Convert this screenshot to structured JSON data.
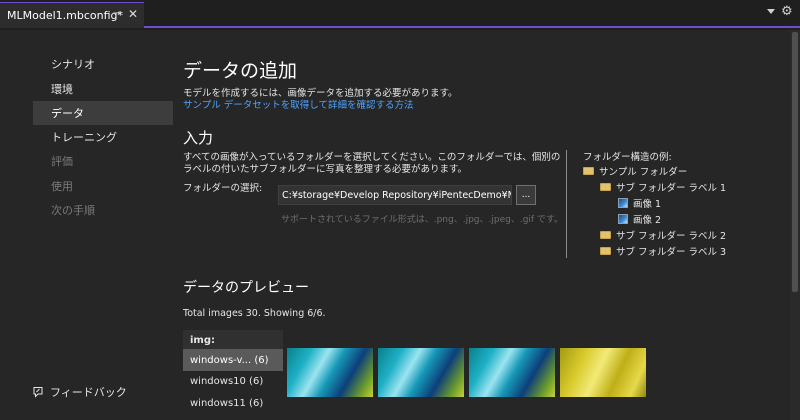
{
  "tab": {
    "title": "MLModel1.mbconfig*",
    "pin": "⊸",
    "close": "✕"
  },
  "sidebar": {
    "items": [
      {
        "label": "シナリオ"
      },
      {
        "label": "環境"
      },
      {
        "label": "データ"
      },
      {
        "label": "トレーニング"
      },
      {
        "label": "評価"
      },
      {
        "label": "使用"
      },
      {
        "label": "次の手順"
      }
    ],
    "feedback": "フィードバック"
  },
  "main": {
    "title": "データの追加",
    "description": "モデルを作成するには、画像データを追加する必要があります。",
    "link": "サンプル データセットを取得して詳細を確認する方法",
    "input": {
      "heading": "入力",
      "description": "すべての画像が入っているフォルダーを選択してください。このフォルダーでは、個別のラベルの付いたサブフォルダーに写真を整理する必要があります。",
      "folder_label": "フォルダーの選択:",
      "folder_value": "C:¥storage¥Develop Repository¥iPentecDemo¥MLnet",
      "browse_label": "...",
      "formats": "サポートされているファイル形式は、.png、.jpg、.jpeg、.gif です。"
    },
    "structure": {
      "title": "フォルダー構造の例:",
      "tree": [
        {
          "label": "サンプル フォルダー",
          "type": "folder"
        },
        {
          "label": "サブ フォルダー ラベル 1",
          "type": "folder"
        },
        {
          "label": "画像 1",
          "type": "image"
        },
        {
          "label": "画像 2",
          "type": "image"
        },
        {
          "label": "サブ フォルダー ラベル 2",
          "type": "folder"
        },
        {
          "label": "サブ フォルダー ラベル 3",
          "type": "folder"
        }
      ]
    },
    "preview": {
      "heading": "データのプレビュー",
      "total": "Total images 30. Showing 6/6.",
      "column_header": "img:",
      "rows": [
        {
          "label": "windows-v... (6)"
        },
        {
          "label": "windows10 (6)"
        },
        {
          "label": "windows11 (6)"
        }
      ]
    }
  },
  "colors": {
    "accent": "#6e4fc9",
    "link": "#4fa3ff",
    "background": "#262626"
  }
}
